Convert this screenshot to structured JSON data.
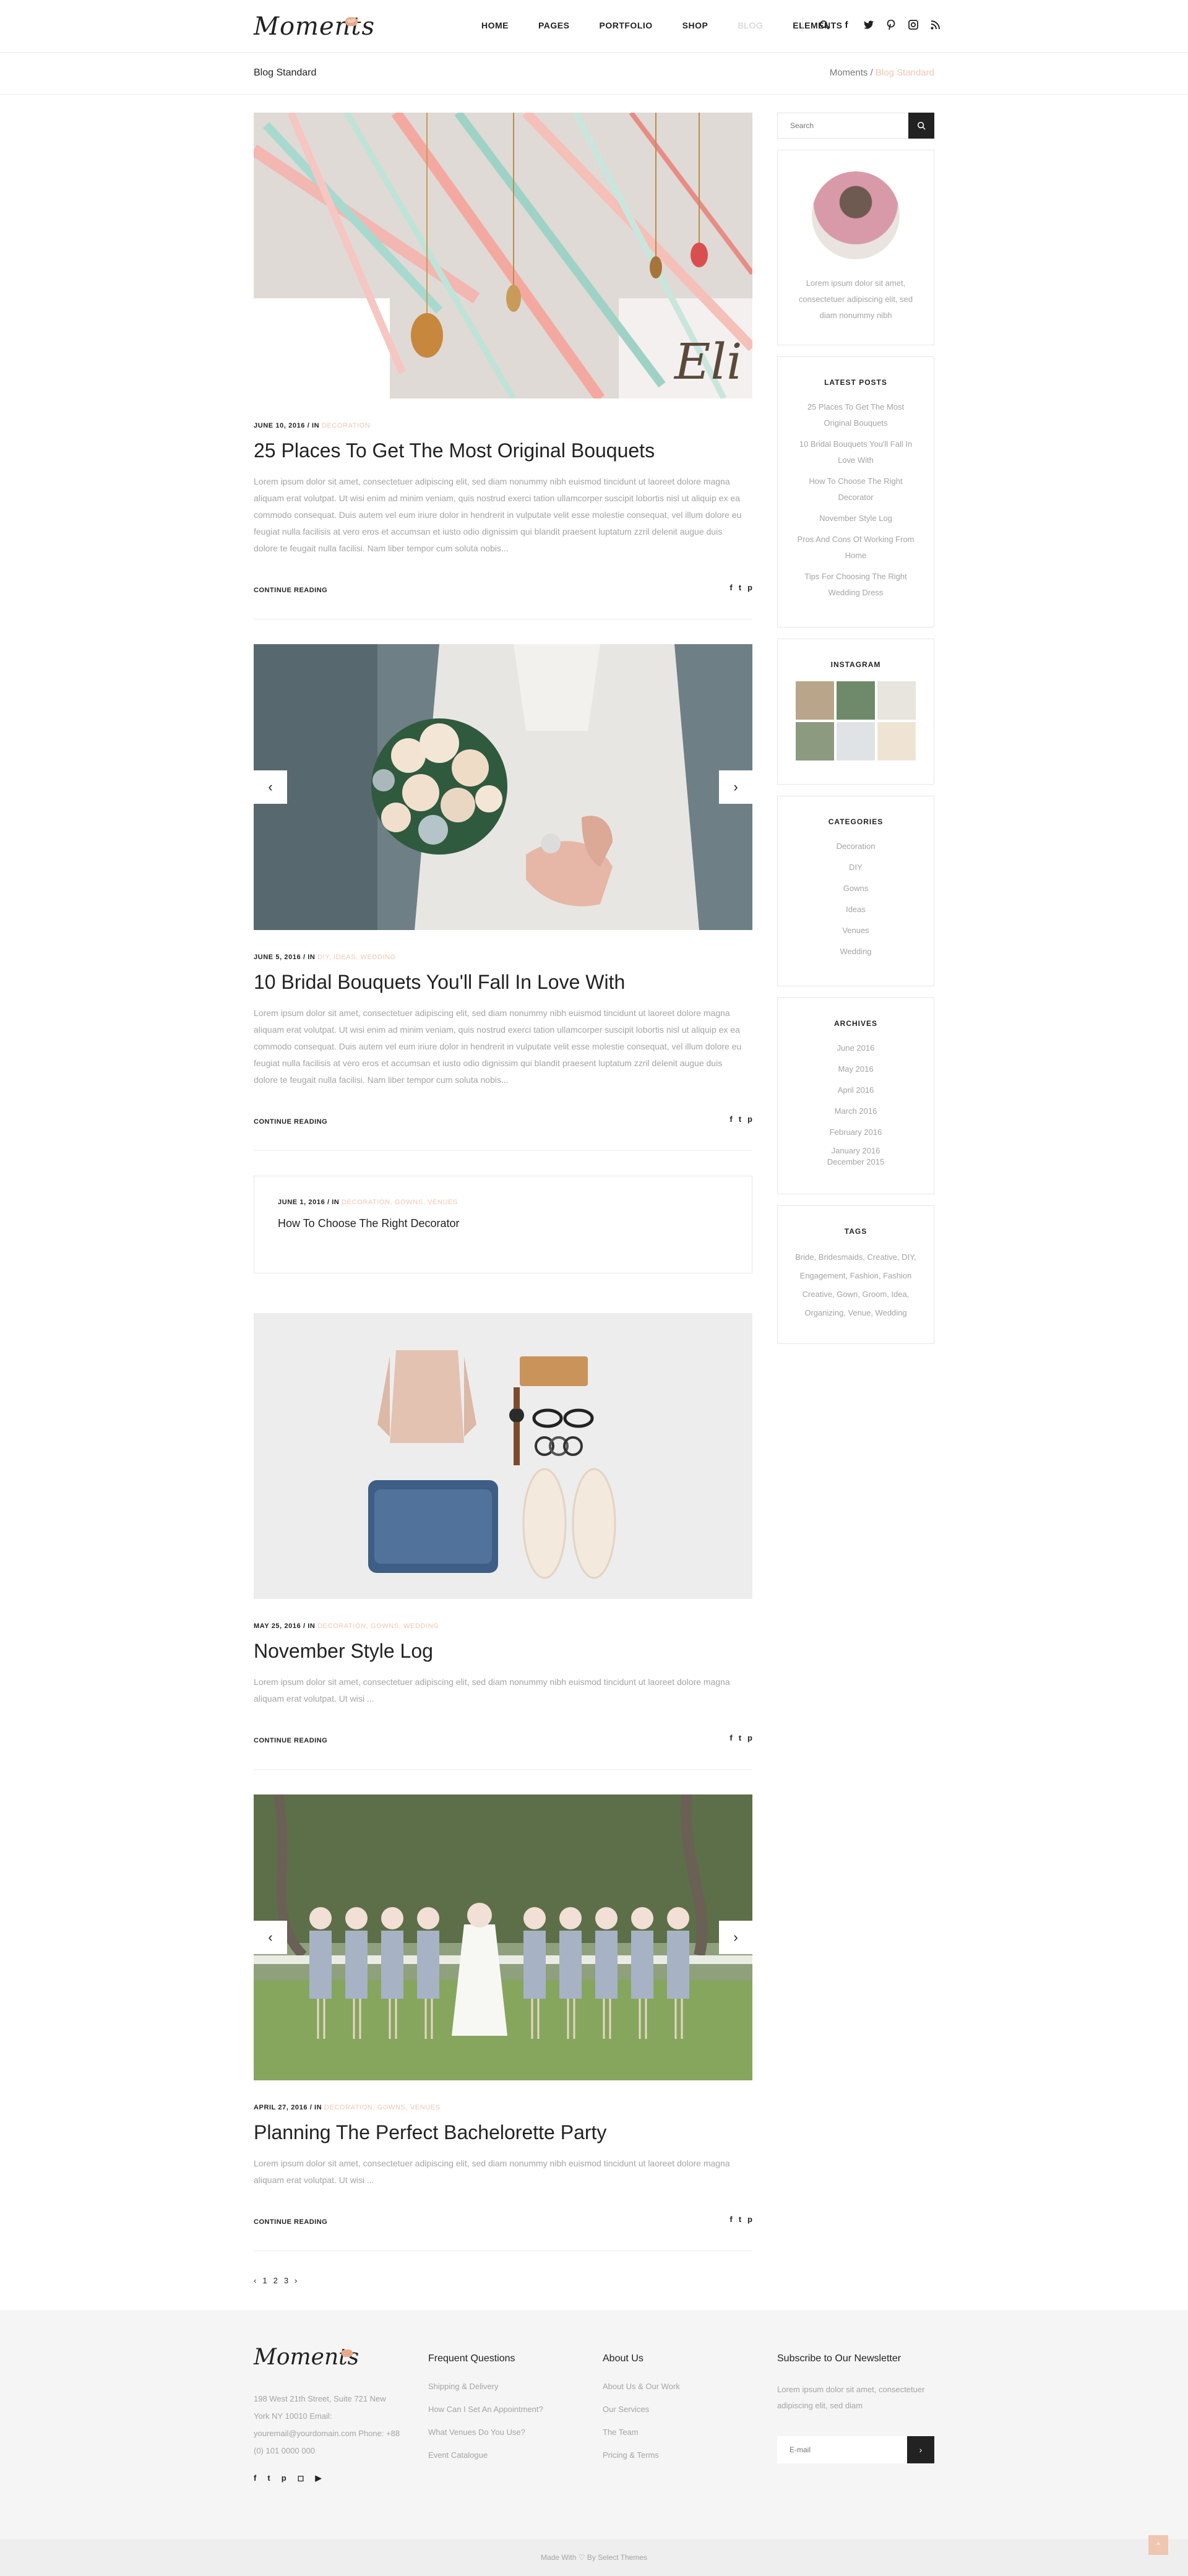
{
  "header": {
    "logo": "Moments",
    "logo_badge": "WP",
    "nav": [
      "HOME",
      "PAGES",
      "PORTFOLIO",
      "SHOP",
      "BLOG",
      "ELEMENTS"
    ],
    "active_nav": "BLOG",
    "icons": [
      "search-icon",
      "facebook-icon",
      "twitter-icon",
      "pinterest-icon",
      "instagram-icon",
      "rss-icon"
    ]
  },
  "titlebar": {
    "title": "Blog Standard",
    "breadcrumb_home": "Moments",
    "breadcrumb_sep": "/",
    "breadcrumb_current": "Blog Standard"
  },
  "posts": [
    {
      "date": "JUNE 10, 2016",
      "in": "/ IN",
      "categories": "DECORATION",
      "title": "25 Places To Get The Most Original Bouquets",
      "excerpt": "Lorem ipsum dolor sit amet, consectetuer adipiscing elit, sed diam nonummy nibh euismod tincidunt ut laoreet dolore magna aliquam erat volutpat. Ut wisi enim ad minim veniam, quis nostrud exerci tation ullamcorper suscipit lobortis nisl ut aliquip ex ea commodo consequat. Duis autem vel eum iriure dolor in hendrerit in vulputate velit esse molestie consequat, vel illum dolore eu feugiat nulla facilisis at vero eros et accumsan et iusto odio dignissim qui blandit praesent luptatum zzril delenit augue duis dolore te feugait nulla facilisi. Nam liber tempor cum soluta nobis...",
      "continue": "CONTINUE READING",
      "image": "hanging-ribbons-photo"
    },
    {
      "date": "JUNE 5, 2016",
      "in": "/ IN",
      "categories": "DIY, IDEAS, WEDDING",
      "title": "10 Bridal Bouquets You'll Fall In Love With",
      "excerpt": "Lorem ipsum dolor sit amet, consectetuer adipiscing elit, sed diam nonummy nibh euismod tincidunt ut laoreet dolore magna aliquam erat volutpat. Ut wisi enim ad minim veniam, quis nostrud exerci tation ullamcorper suscipit lobortis nisl ut aliquip ex ea commodo consequat. Duis autem vel eum iriure dolor in hendrerit in vulputate velit esse molestie consequat, vel illum dolore eu feugiat nulla facilisis at vero eros et accumsan et iusto odio dignissim qui blandit praesent luptatum zzril delenit augue duis dolore te feugait nulla facilisi. Nam liber tempor cum soluta nobis...",
      "continue": "CONTINUE READING",
      "image": "bridal-bouquet-photo"
    }
  ],
  "quote_post": {
    "date": "JUNE 1, 2016",
    "in": "/ IN",
    "categories": "DECORATION, GOWNS, VENUES",
    "title": "How To Choose The Right Decorator"
  },
  "posts2": [
    {
      "date": "MAY 25, 2016",
      "in": "/ IN",
      "categories": "DECORATION, GOWNS, WEDDING",
      "title": "November Style Log",
      "excerpt": "Lorem ipsum dolor sit amet, consectetuer adipiscing elit, sed diam nonummy nibh euismod tincidunt ut laoreet dolore magna aliquam erat volutpat. Ut wisi ...",
      "continue": "CONTINUE READING",
      "image": "flatlay-style-photo"
    },
    {
      "date": "APRIL 27, 2016",
      "in": "/ IN",
      "categories": "DECORATION, GOWNS, VENUES",
      "title": "Planning The Perfect Bachelorette Party",
      "excerpt": "Lorem ipsum dolor sit amet, consectetuer adipiscing elit, sed diam nonummy nibh euismod tincidunt ut laoreet dolore magna aliquam erat volutpat. Ut wisi ...",
      "continue": "CONTINUE READING",
      "image": "bridesmaids-photo"
    }
  ],
  "pagination": [
    "‹",
    "1",
    "2",
    "3",
    "›"
  ],
  "sidebar": {
    "search_placeholder": "Search",
    "about_text": "Lorem ipsum dolor sit amet, consectetuer adipiscing elit, sed diam nonummy nibh",
    "latest_title": "LATEST POSTS",
    "latest_posts": [
      "25 Places To Get The Most Original Bouquets",
      "10 Bridal Bouquets You'll Fall In Love With",
      "How To Choose The Right Decorator",
      "November Style Log",
      "Pros And Cons Of Working From Home",
      "Tips For Choosing The Right Wedding Dress"
    ],
    "instagram_title": "INSTAGRAM",
    "categories_title": "CATEGORIES",
    "categories": [
      "Decoration",
      "DIY",
      "Gowns",
      "Ideas",
      "Venues",
      "Wedding"
    ],
    "archives_title": "ARCHIVES",
    "archives": [
      "June 2016",
      "May 2016",
      "April 2016",
      "March 2016",
      "February 2016",
      "January 2016",
      "December 2015"
    ],
    "tags_title": "TAGS",
    "tags": "Bride, Bridesmaids, Creative, DIY, Engagement, Fashion, Fashion Creative, Gown, Groom, Idea, Organizing, Venue, Wedding"
  },
  "footer": {
    "logo": "Moments",
    "address": "198 West 21th Street, Suite 721 New York NY 10010 Email: youremail@yourdomain.com Phone: +88 (0) 101 0000 000",
    "col1_title": "Frequent Questions",
    "col1_links": [
      "Shipping & Delivery",
      "How Can I Set An Appointment?",
      "What Venues Do You Use?",
      "Event Catalogue"
    ],
    "col2_title": "About Us",
    "col2_links": [
      "About Us & Our Work",
      "Our Services",
      "The Team",
      "Pricing & Terms"
    ],
    "col3_title": "Subscribe to Our Newsletter",
    "col3_text": "Lorem ipsum dolor sit amet, consectetuer adipiscing elit, sed diam",
    "email_placeholder": "E-mail",
    "copyright": "Made With ♡ By Select Themes"
  }
}
